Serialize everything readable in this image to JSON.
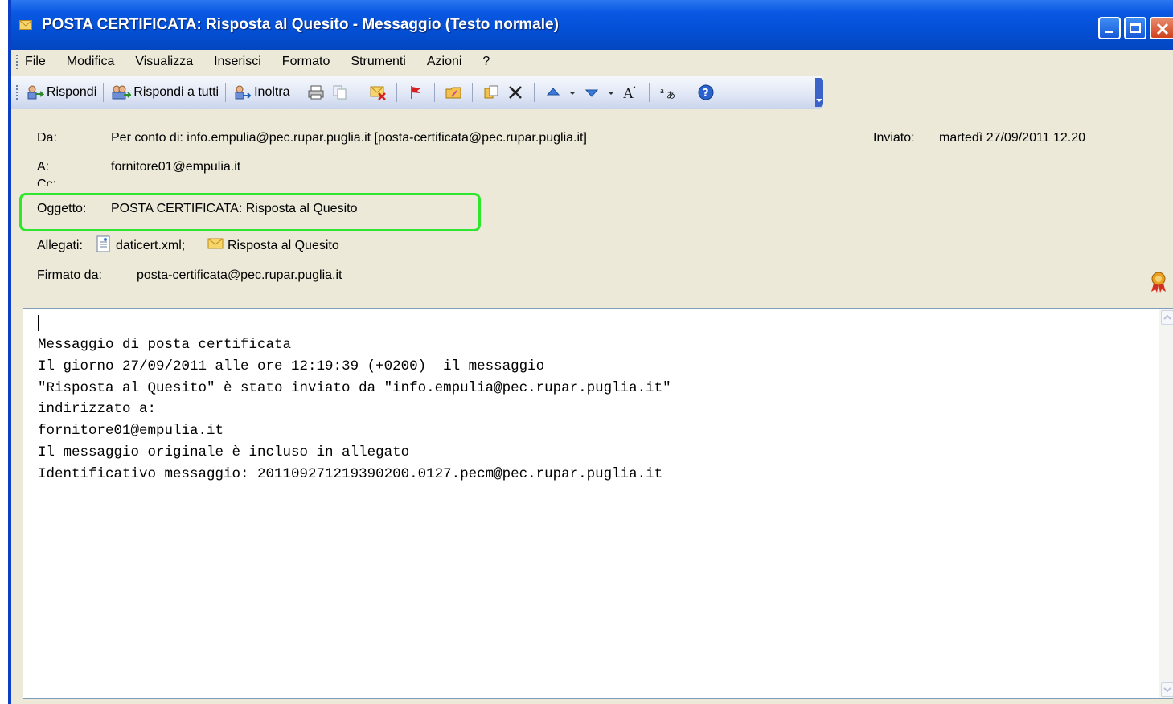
{
  "window": {
    "title": "POSTA CERTIFICATA: Risposta al Quesito - Messaggio (Testo normale)"
  },
  "menu": {
    "items": [
      "File",
      "Modifica",
      "Visualizza",
      "Inserisci",
      "Formato",
      "Strumenti",
      "Azioni",
      "?"
    ]
  },
  "toolbar": {
    "reply_label": "Rispondi",
    "reply_all_label": "Rispondi a tutti",
    "forward_label": "Inoltra"
  },
  "header": {
    "from_label": "Da:",
    "from_value": "Per conto di: info.empulia@pec.rupar.puglia.it [posta-certificata@pec.rupar.puglia.it]",
    "sent_label": "Inviato:",
    "sent_value": "martedì 27/09/2011 12.20",
    "to_label": "A:",
    "to_value": "fornitore01@empulia.it",
    "cc_label": "Cc:",
    "subject_label": "Oggetto:",
    "subject_value": "POSTA CERTIFICATA: Risposta al Quesito",
    "attachments_label": "Allegati:",
    "attachment_1": "daticert.xml;",
    "attachment_2": "Risposta al Quesito",
    "signed_label": "Firmato da:",
    "signed_value": "posta-certificata@pec.rupar.puglia.it"
  },
  "body": {
    "lines": [
      "Messaggio di posta certificata",
      "Il giorno 27/09/2011 alle ore 12:19:39 (+0200)  il messaggio",
      "\"Risposta al Quesito\" è stato inviato da \"info.empulia@pec.rupar.puglia.it\"",
      "indirizzato a:",
      "fornitore01@empulia.it",
      "Il messaggio originale è incluso in allegato",
      "Identificativo messaggio: 20110927121939020​0.0127.pecm@pec.rupar.puglia.it"
    ]
  },
  "colors": {
    "titlebar": "#0350d6",
    "highlight_box": "#2ee62e",
    "window_bg": "#ece9d8"
  }
}
